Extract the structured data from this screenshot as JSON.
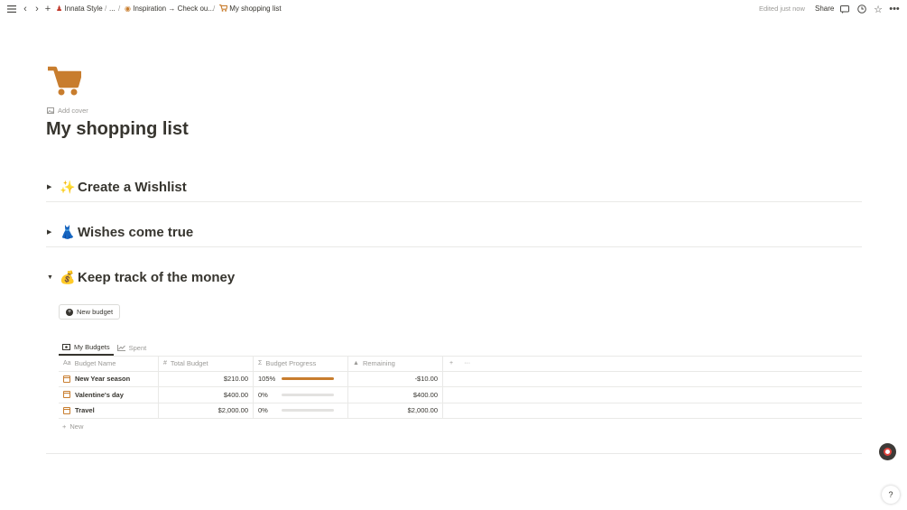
{
  "topbar": {
    "breadcrumbs": [
      {
        "label": "Innata Style",
        "icon": "person-icon"
      },
      {
        "label": "..."
      },
      {
        "label": "Inspiration → Check ou...",
        "icon": "eye-icon"
      },
      {
        "label": "My shopping list",
        "icon": "cart-icon"
      }
    ],
    "edited": "Edited just now",
    "share": "Share"
  },
  "page": {
    "add_cover": "Add cover",
    "title": "My shopping list",
    "accent": "#c87d2e"
  },
  "toggles": [
    {
      "emoji": "✨",
      "heading": "Create a Wishlist",
      "open": false
    },
    {
      "emoji": "👗",
      "heading": "Wishes come true",
      "open": false
    },
    {
      "emoji": "💰",
      "heading": "Keep track of the money",
      "open": true
    }
  ],
  "new_budget": "New budget",
  "views": [
    {
      "label": "My Budgets",
      "active": true
    },
    {
      "label": "Spent",
      "active": false
    }
  ],
  "table": {
    "columns": [
      "Budget Name",
      "Total Budget",
      "Budget Progress",
      "Remaining"
    ],
    "rows": [
      {
        "name": "New Year season",
        "total": "$210.00",
        "progress_label": "105%",
        "progress": 1.0,
        "remaining": "-$10.00"
      },
      {
        "name": "Valentine's day",
        "total": "$400.00",
        "progress_label": "0%",
        "progress": 0.0,
        "remaining": "$400.00"
      },
      {
        "name": "Travel",
        "total": "$2,000.00",
        "progress_label": "0%",
        "progress": 0.0,
        "remaining": "$2,000.00"
      }
    ],
    "new_row": "New"
  },
  "help": "?"
}
